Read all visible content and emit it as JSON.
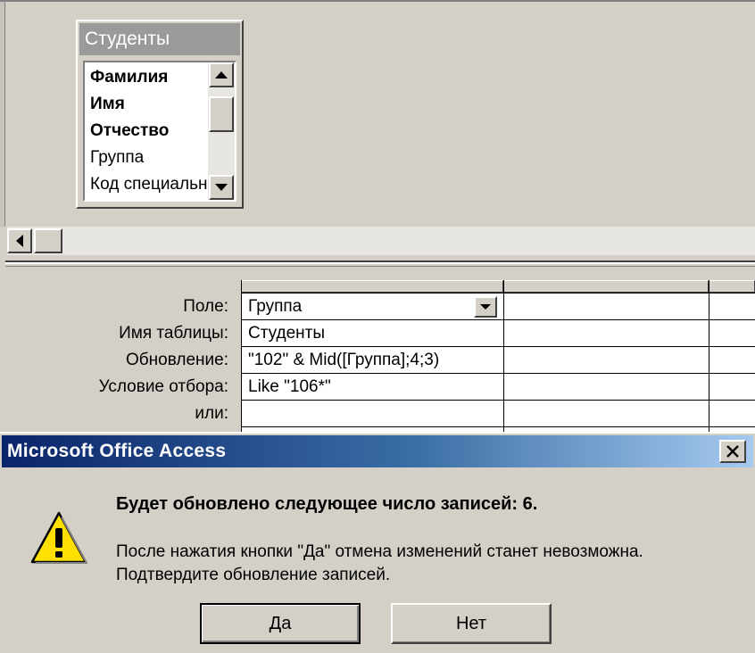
{
  "design_pane": {
    "table": {
      "title": "Студенты",
      "fields": [
        {
          "label": "Фамилия",
          "bold": true
        },
        {
          "label": "Имя",
          "bold": true
        },
        {
          "label": "Отчество",
          "bold": true
        },
        {
          "label": "Группа",
          "bold": false
        },
        {
          "label": "Код специальности",
          "bold": false
        }
      ]
    }
  },
  "grid": {
    "row_labels": {
      "field": "Поле:",
      "table": "Имя таблицы:",
      "update": "Обновление:",
      "criteria": "Условие отбора:",
      "or": "или:"
    },
    "column1": {
      "field": "Группа",
      "table": "Студенты",
      "update": "\"102\" & Mid([Группа];4;3)",
      "criteria": "Like \"106*\"",
      "or": ""
    }
  },
  "dialog": {
    "title": "Microsoft Office Access",
    "message_main": "Будет обновлено следующее число записей: 6.",
    "message_line1": "После нажатия кнопки \"Да\" отмена изменений станет невозможна.",
    "message_line2": "Подтвердите обновление записей.",
    "buttons": {
      "yes": "Да",
      "no": "Нет"
    },
    "icon": "warning-icon",
    "colors": {
      "title_start": "#0a246a",
      "title_end": "#a6caf0",
      "warning_fill": "#ffe000"
    }
  }
}
